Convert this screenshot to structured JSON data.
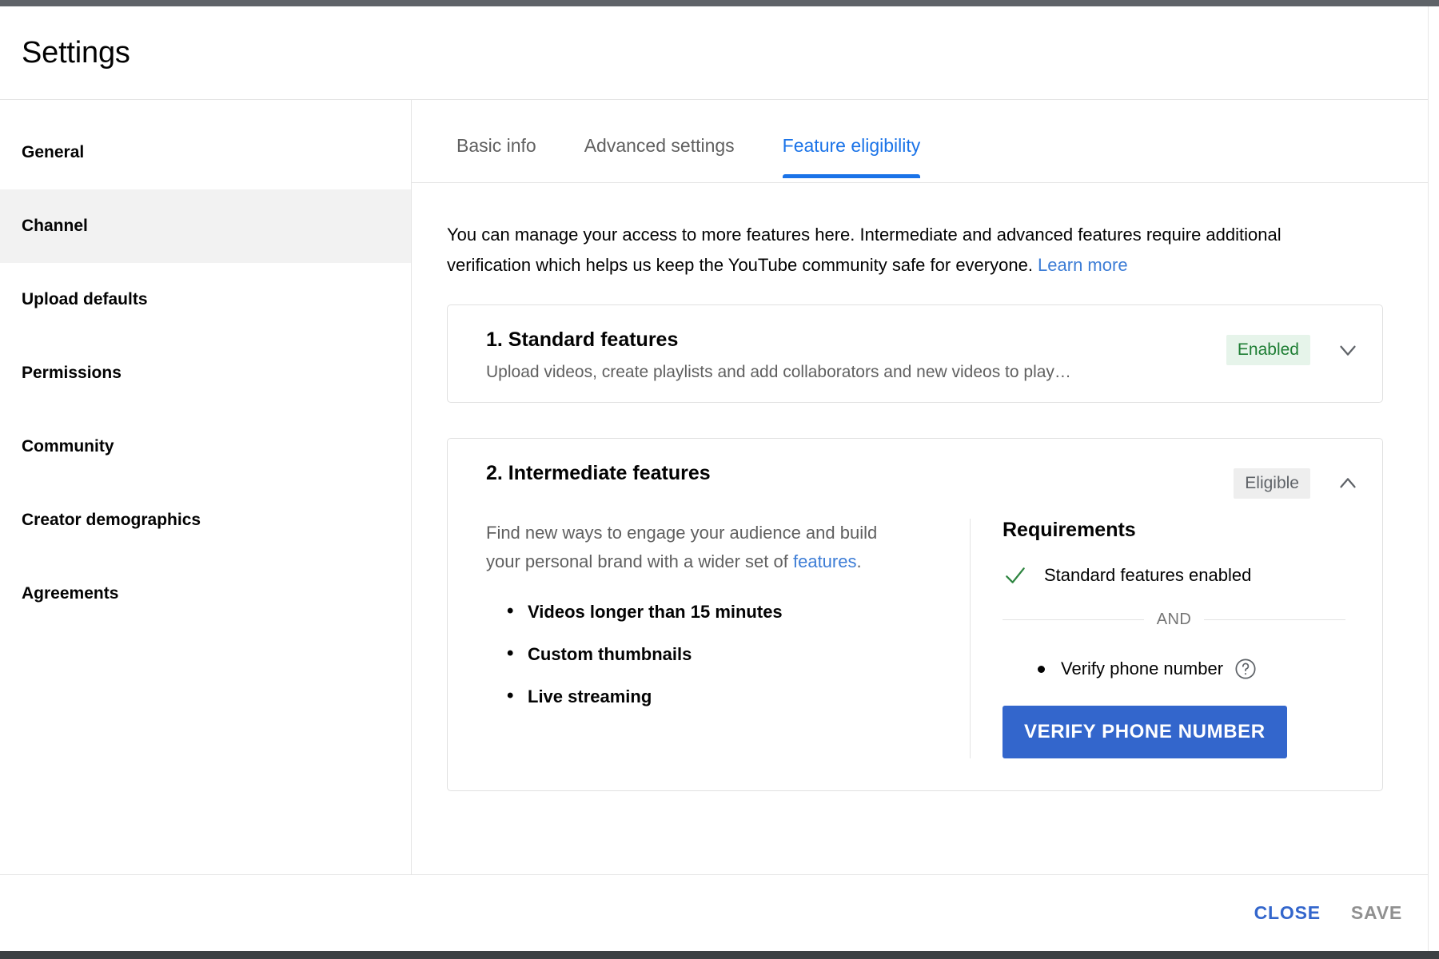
{
  "window": {
    "title": "Settings"
  },
  "sidebar": {
    "items": [
      {
        "label": "General",
        "active": false
      },
      {
        "label": "Channel",
        "active": true
      },
      {
        "label": "Upload defaults",
        "active": false
      },
      {
        "label": "Permissions",
        "active": false
      },
      {
        "label": "Community",
        "active": false
      },
      {
        "label": "Creator demographics",
        "active": false
      },
      {
        "label": "Agreements",
        "active": false
      }
    ]
  },
  "tabs": [
    {
      "label": "Basic info",
      "active": false
    },
    {
      "label": "Advanced settings",
      "active": false
    },
    {
      "label": "Feature eligibility",
      "active": true
    }
  ],
  "panel": {
    "intro_text": "You can manage your access to more features here. Intermediate and advanced features require additional verification which helps us keep the YouTube community safe for everyone. ",
    "intro_link": "Learn more"
  },
  "cards": [
    {
      "title": "1. Standard features",
      "subtitle": "Upload videos, create playlists and add collaborators and new videos to play…",
      "badge": "Enabled",
      "badge_kind": "enabled",
      "expanded": false,
      "chevron": "chevron-down-icon"
    },
    {
      "title": "2. Intermediate features",
      "badge": "Eligible",
      "badge_kind": "eligible",
      "expanded": true,
      "chevron": "chevron-up-icon",
      "description_before": "Find new ways to engage your audience and build your personal brand with a wider set of ",
      "description_link": "features",
      "description_after": ".",
      "features": [
        "Videos longer than 15 minutes",
        "Custom thumbnails",
        "Live streaming"
      ],
      "requirements": {
        "title": "Requirements",
        "met_item": "Standard features enabled",
        "conjunction": "AND",
        "pending_item": "Verify phone number",
        "help_icon": "help-circle-icon",
        "action_label": "VERIFY PHONE NUMBER"
      }
    }
  ],
  "footer": {
    "close_label": "CLOSE",
    "save_label": "SAVE"
  },
  "colors": {
    "accent_blue": "#1a73e8",
    "button_blue": "#3366cc",
    "link_blue": "#3d7dd6",
    "badge_enabled_bg": "#e6f4ea",
    "badge_enabled_fg": "#1e7e34",
    "badge_eligible_bg": "#eeeeee",
    "badge_eligible_fg": "#5f6368",
    "check_green": "#2e8540"
  }
}
